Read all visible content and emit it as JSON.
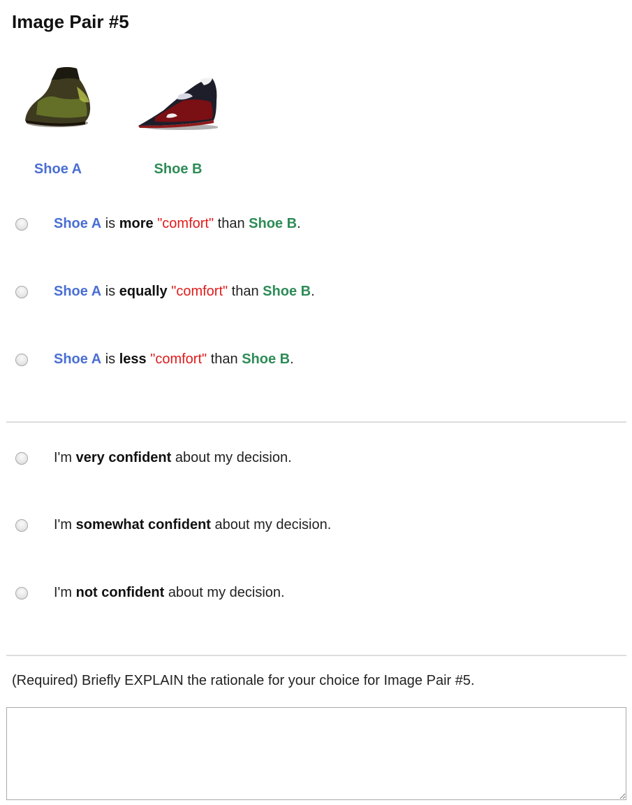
{
  "header": {
    "title": "Image Pair #5"
  },
  "shoes": {
    "a": {
      "label": "Shoe A"
    },
    "b": {
      "label": "Shoe B"
    }
  },
  "comparison": {
    "subject": "Shoe A",
    "verb": "is",
    "attribute": "\"comfort\"",
    "connector": "than",
    "object": "Shoe B",
    "end": ".",
    "options": [
      {
        "degree": "more"
      },
      {
        "degree": "equally"
      },
      {
        "degree": "less"
      }
    ]
  },
  "confidence": {
    "prefix": "I'm",
    "suffix": "about my decision.",
    "options": [
      {
        "level": "very confident"
      },
      {
        "level": "somewhat confident"
      },
      {
        "level": "not confident"
      }
    ]
  },
  "explanation": {
    "prompt": "(Required) Briefly EXPLAIN the rationale for your choice for Image Pair #5.",
    "value": ""
  },
  "colors": {
    "shoe_a": "#4a6fd3",
    "shoe_b": "#2e8b57",
    "attribute": "#e01b1b"
  },
  "icons": {
    "shoe_a_image": "dark-olive-loafer-photo",
    "shoe_b_image": "red-black-sneaker-photo"
  }
}
